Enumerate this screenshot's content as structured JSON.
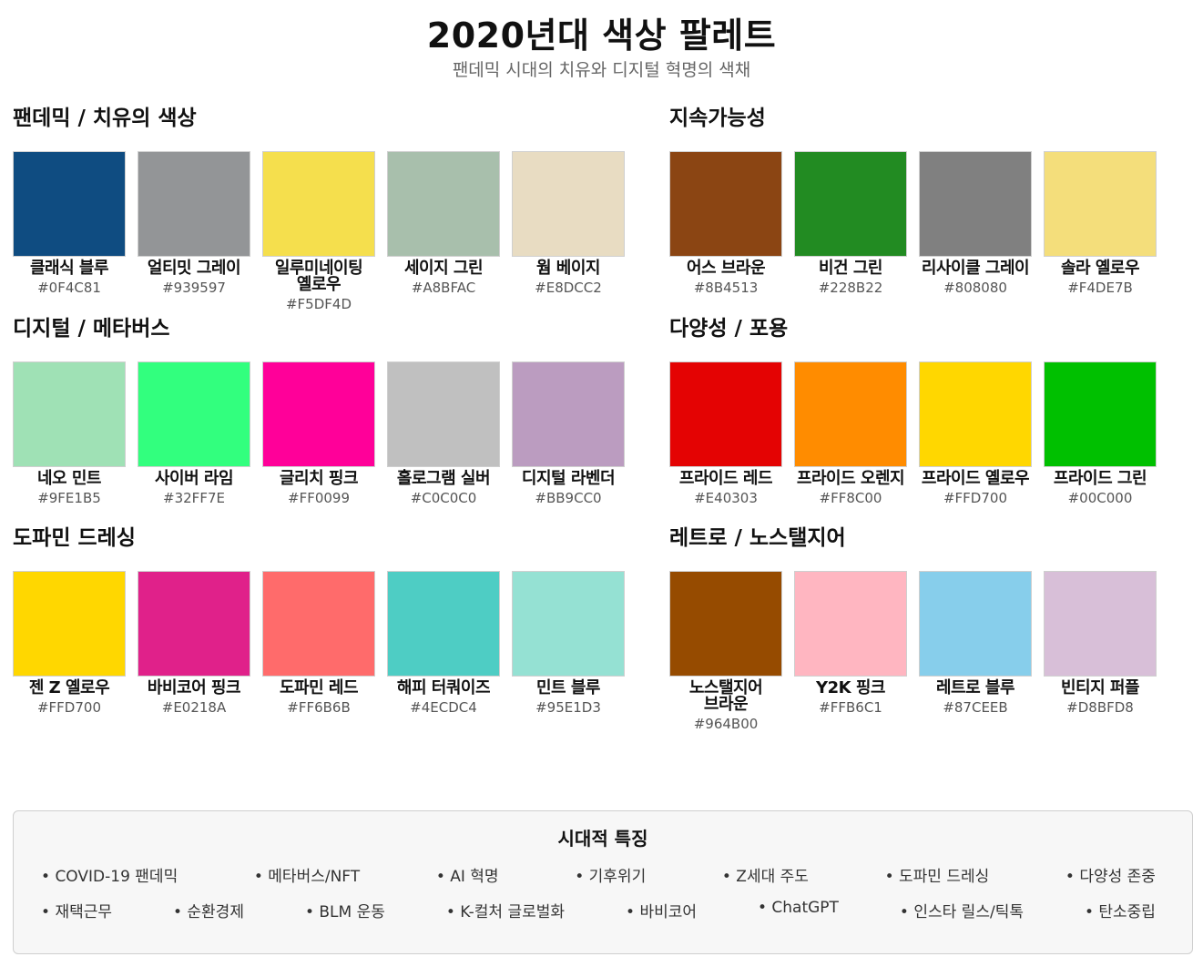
{
  "page": {
    "title": "2020년대 색상 팔레트",
    "subtitle": "팬데믹 시대의 치유와 디지털 혁명의 색채"
  },
  "sections": [
    {
      "title": "팬데믹 / 치유의 색상",
      "swatches": [
        {
          "name": "클래식 블루",
          "hex": "#0F4C81"
        },
        {
          "name": "얼티밋 그레이",
          "hex": "#939597"
        },
        {
          "name": "일루미네이팅 옐로우",
          "hex": "#F5DF4D"
        },
        {
          "name": "세이지 그린",
          "hex": "#A8BFAC"
        },
        {
          "name": "웜 베이지",
          "hex": "#E8DCC2"
        }
      ]
    },
    {
      "title": "지속가능성",
      "swatches": [
        {
          "name": "어스 브라운",
          "hex": "#8B4513"
        },
        {
          "name": "비건 그린",
          "hex": "#228B22"
        },
        {
          "name": "리사이클 그레이",
          "hex": "#808080"
        },
        {
          "name": "솔라 옐로우",
          "hex": "#F4DE7B"
        }
      ]
    },
    {
      "title": "디지털 / 메타버스",
      "swatches": [
        {
          "name": "네오 민트",
          "hex": "#9FE1B5"
        },
        {
          "name": "사이버 라임",
          "hex": "#32FF7E"
        },
        {
          "name": "글리치 핑크",
          "hex": "#FF0099"
        },
        {
          "name": "홀로그램 실버",
          "hex": "#C0C0C0"
        },
        {
          "name": "디지털 라벤더",
          "hex": "#BB9CC0"
        }
      ]
    },
    {
      "title": "다양성 / 포용",
      "swatches": [
        {
          "name": "프라이드 레드",
          "hex": "#E40303"
        },
        {
          "name": "프라이드 오렌지",
          "hex": "#FF8C00"
        },
        {
          "name": "프라이드 옐로우",
          "hex": "#FFD700"
        },
        {
          "name": "프라이드 그린",
          "hex": "#00C000"
        }
      ]
    },
    {
      "title": "도파민 드레싱",
      "swatches": [
        {
          "name": "젠 Z 옐로우",
          "hex": "#FFD700"
        },
        {
          "name": "바비코어 핑크",
          "hex": "#E0218A"
        },
        {
          "name": "도파민 레드",
          "hex": "#FF6B6B"
        },
        {
          "name": "해피 터쿼이즈",
          "hex": "#4ECDC4"
        },
        {
          "name": "민트 블루",
          "hex": "#95E1D3"
        }
      ]
    },
    {
      "title": "레트로 / 노스탤지어",
      "swatches": [
        {
          "name": "노스탤지어 브라운",
          "hex": "#964B00"
        },
        {
          "name": "Y2K 핑크",
          "hex": "#FFB6C1"
        },
        {
          "name": "레트로 블루",
          "hex": "#87CEEB"
        },
        {
          "name": "빈티지 퍼플",
          "hex": "#D8BFD8"
        }
      ]
    }
  ],
  "features": {
    "title": "시대적 특징",
    "row1": [
      "COVID-19 팬데믹",
      "메타버스/NFT",
      "AI 혁명",
      "기후위기",
      "Z세대 주도",
      "도파민 드레싱",
      "다양성 존중"
    ],
    "row2": [
      "재택근무",
      "순환경제",
      "BLM 운동",
      "K-컬처 글로벌화",
      "바비코어",
      "ChatGPT",
      "인스타 릴스/틱톡",
      "탄소중립"
    ]
  }
}
